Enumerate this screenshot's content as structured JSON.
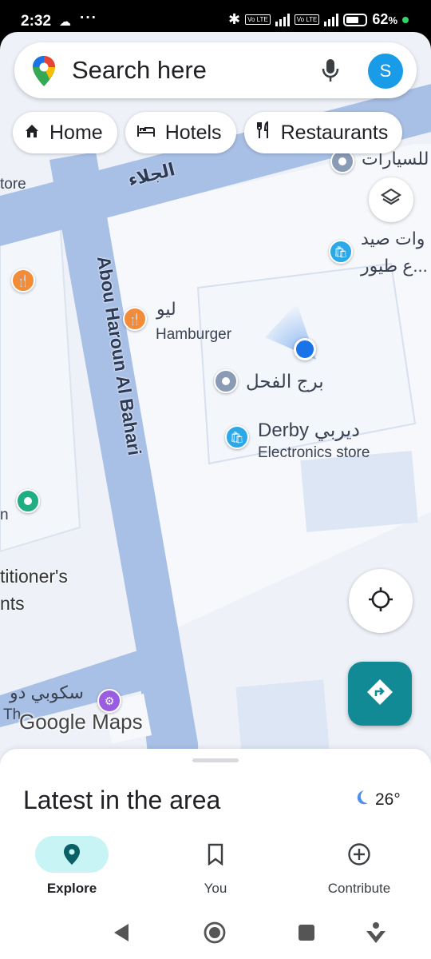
{
  "status_bar": {
    "time": "2:32",
    "battery": "62",
    "battery_unit": "%"
  },
  "search": {
    "placeholder": "Search here",
    "avatar_letter": "S"
  },
  "chips": [
    {
      "label": "Home",
      "icon": "home-icon"
    },
    {
      "label": "Hotels",
      "icon": "bed-icon"
    },
    {
      "label": "Restaurants",
      "icon": "utensils-icon"
    }
  ],
  "map": {
    "road_labels": {
      "main_street": "Abou Haroun Al Bahari",
      "top_street": "الجلاء"
    },
    "places": {
      "hamburger_ar": "ليو",
      "hamburger_en": "Hamburger",
      "tower": "برج الفحل",
      "derby_name": "Derby ديربي",
      "derby_category": "Electronics store",
      "pet_line1": "وات صيد",
      "pet_line2": "ع طيور...",
      "cars": "للسيارات",
      "store_partial": "tore",
      "confectioner_line1": "titioner's",
      "confectioner_line2": "nts",
      "scooby_ar": "سكوبي دو",
      "scooby_en": "Th",
      "left_partial": "n"
    },
    "logo": "Google Maps"
  },
  "sheet": {
    "title": "Latest in the area",
    "temperature": "26°",
    "weather_icon": "moon-icon"
  },
  "bottom_nav": [
    {
      "label": "Explore",
      "icon": "location-pin-icon",
      "active": true
    },
    {
      "label": "You",
      "icon": "bookmark-icon",
      "active": false
    },
    {
      "label": "Contribute",
      "icon": "add-circle-icon",
      "active": false
    }
  ],
  "colors": {
    "accent": "#128a95",
    "my_location": "#1a73e8",
    "road": "#a9c0e6",
    "map_bg": "#eef2f8"
  }
}
